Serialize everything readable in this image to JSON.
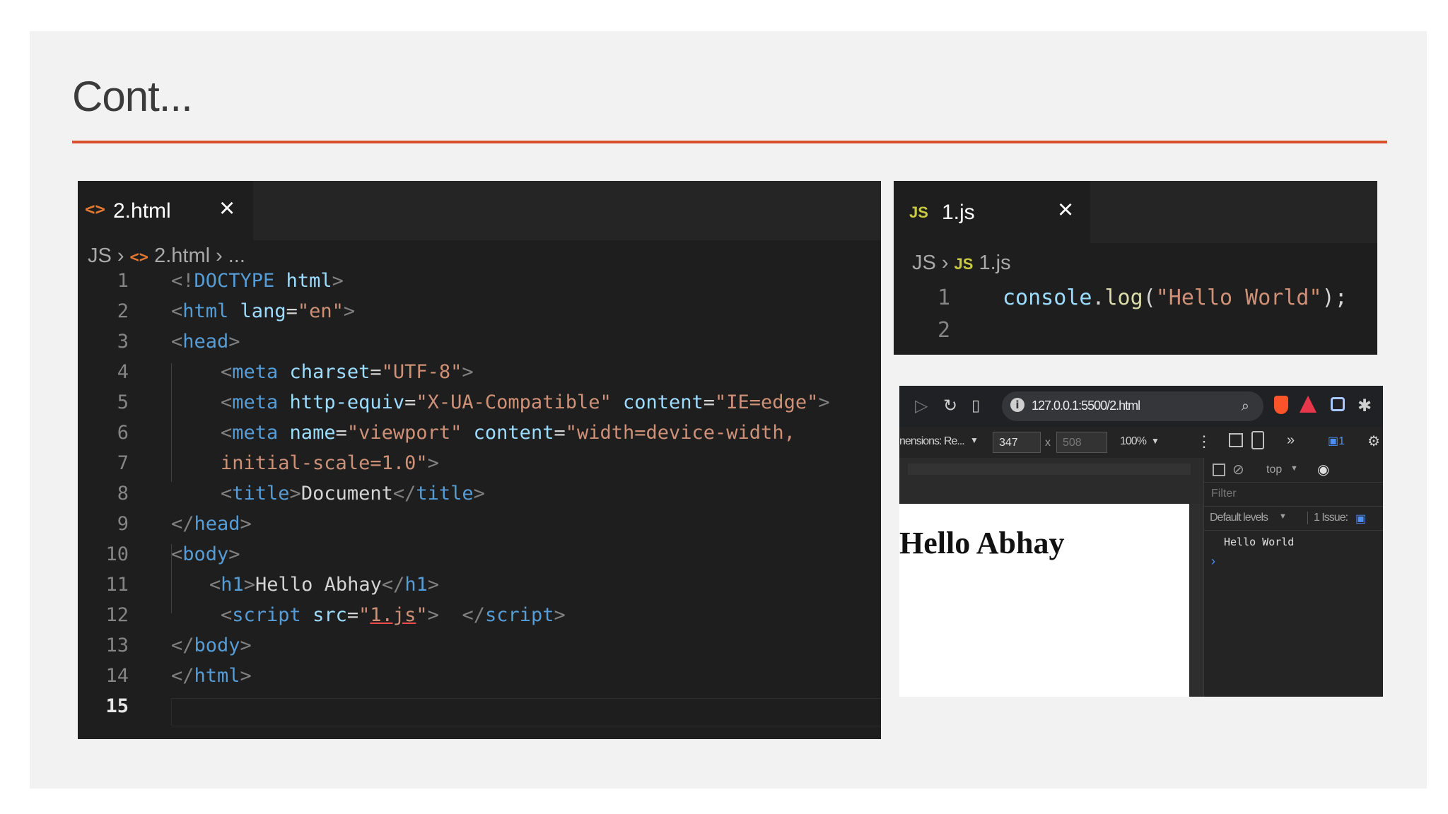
{
  "slide": {
    "title": "Cont...",
    "accent_color": "#d9502a"
  },
  "html_editor": {
    "tab": {
      "icon": "html-file-icon",
      "label": "2.html",
      "close": "×"
    },
    "breadcrumb": {
      "part1": "JS",
      "part2": "2.html",
      "part3": "..."
    },
    "line_numbers": [
      "1",
      "2",
      "3",
      "4",
      "5",
      "6",
      "7",
      "8",
      "9",
      "10",
      "11",
      "12",
      "13",
      "14",
      "15"
    ],
    "active_line": "15",
    "code": {
      "l1": {
        "p1": "<!",
        "kw": "DOCTYPE",
        "attr": " html",
        "p2": ">"
      },
      "l2": {
        "p1": "<",
        "tag": "html",
        "attr": " lang",
        "eq": "=",
        "val": "\"en\"",
        "p2": ">"
      },
      "l3": {
        "p1": "<",
        "tag": "head",
        "p2": ">"
      },
      "l4": {
        "p1": "<",
        "tag": "meta",
        "attr": " charset",
        "eq": "=",
        "val": "\"UTF-8\"",
        "p2": ">"
      },
      "l5": {
        "p1": "<",
        "tag": "meta",
        "attr1": " http-equiv",
        "eq1": "=",
        "val1": "\"X-UA-Compatible\"",
        "attr2": " content",
        "eq2": "=",
        "val2": "\"IE=edge\"",
        "p2": ">"
      },
      "l6": {
        "p1": "<",
        "tag": "meta",
        "attr1": " name",
        "eq1": "=",
        "val1": "\"viewport\"",
        "attr2": " content",
        "eq2": "=",
        "val2": "\"width=device-width,"
      },
      "l7": {
        "val": "initial-scale=1.0\"",
        "p2": ">"
      },
      "l8": {
        "p1": "<",
        "tag": "title",
        "p2": ">",
        "text": "Document",
        "p3": "</",
        "tag2": "title",
        "p4": ">"
      },
      "l9": {
        "p1": "</",
        "tag": "head",
        "p2": ">"
      },
      "l10": {
        "p1": "<",
        "tag": "body",
        "p2": ">"
      },
      "l11": {
        "p1": "<",
        "tag": "h1",
        "p2": ">",
        "text": "Hello Abhay",
        "p3": "</",
        "tag2": "h1",
        "p4": ">"
      },
      "l12": {
        "p1": "<",
        "tag": "script",
        "attr": " src",
        "eq": "=",
        "q1": "\"",
        "val": "1.js",
        "q2": "\"",
        "p2": ">",
        "sp": "  ",
        "p3": "</",
        "tag2": "script",
        "p4": ">"
      },
      "l13": {
        "p1": "</",
        "tag": "body",
        "p2": ">"
      },
      "l14": {
        "p1": "</",
        "tag": "html",
        "p2": ">"
      }
    }
  },
  "js_editor": {
    "tab": {
      "icon": "js-file-icon",
      "icon_text": "JS",
      "label": "1.js",
      "close": "×"
    },
    "breadcrumb": {
      "part1": "JS",
      "icon_text": "JS",
      "part2": "1.js"
    },
    "line_numbers": [
      "1",
      "2"
    ],
    "code": {
      "obj": "console",
      "dot": ".",
      "fn": "log",
      "open": "(",
      "str": "\"Hello World\"",
      "close": ");"
    }
  },
  "browser": {
    "url": "127.0.0.1:5500/2.html",
    "dimensions_label": "nensions: Re...",
    "width_value": "347",
    "times": "x",
    "height_value": "508",
    "zoom": "100%",
    "context": "top",
    "filter_placeholder": "Filter",
    "levels": "Default levels",
    "issues": "1 Issue:",
    "issue_count": "1",
    "page_heading": "Hello Abhay",
    "console_message": "Hello World",
    "console_prompt": "›",
    "badge_count": "1"
  }
}
